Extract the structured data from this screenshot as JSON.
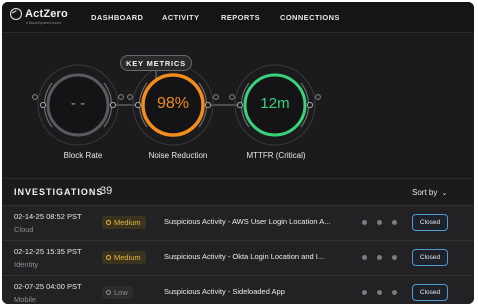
{
  "brand": {
    "name": "ActZero",
    "tagline": "a BlackSquared brand"
  },
  "nav": {
    "items": [
      {
        "label": "DASHBOARD"
      },
      {
        "label": "ACTIVITY"
      },
      {
        "label": "REPORTS"
      },
      {
        "label": "CONNECTIONS"
      }
    ]
  },
  "key_metrics": {
    "title": "KEY METRICS",
    "metrics": [
      {
        "label": "Block Rate",
        "value": "- -",
        "color": "#9a9a9e"
      },
      {
        "label": "Noise Reduction",
        "value": "98%",
        "color": "#f28c1b"
      },
      {
        "label": "MTTFR (Critical)",
        "value": "12m",
        "color": "#39d17a"
      }
    ]
  },
  "investigations": {
    "title": "INVESTIGATIONS",
    "count": "39",
    "sort_label": "Sort by",
    "rows": [
      {
        "date": "02-14-25 08:52 PST",
        "source": "Cloud",
        "severity": "Medium",
        "title": "Suspicious Activity - AWS User Login Location A...",
        "status": "Closed"
      },
      {
        "date": "02-12-25 15:35 PST",
        "source": "Identity",
        "severity": "Medium",
        "title": "Suspicious Activity - Okta Login Location and I...",
        "status": "Closed"
      },
      {
        "date": "02-07-25 04:00 PST",
        "source": "Mobile",
        "severity": "Low",
        "title": "Suspicious Activity - Sideloaded App",
        "status": "Closed"
      }
    ]
  },
  "colors": {
    "background": "#1b1b1d",
    "accent_orange": "#f28c1b",
    "accent_green": "#39d17a",
    "medium_severity": "#e6b93a",
    "button_border": "#4f9bd3"
  }
}
